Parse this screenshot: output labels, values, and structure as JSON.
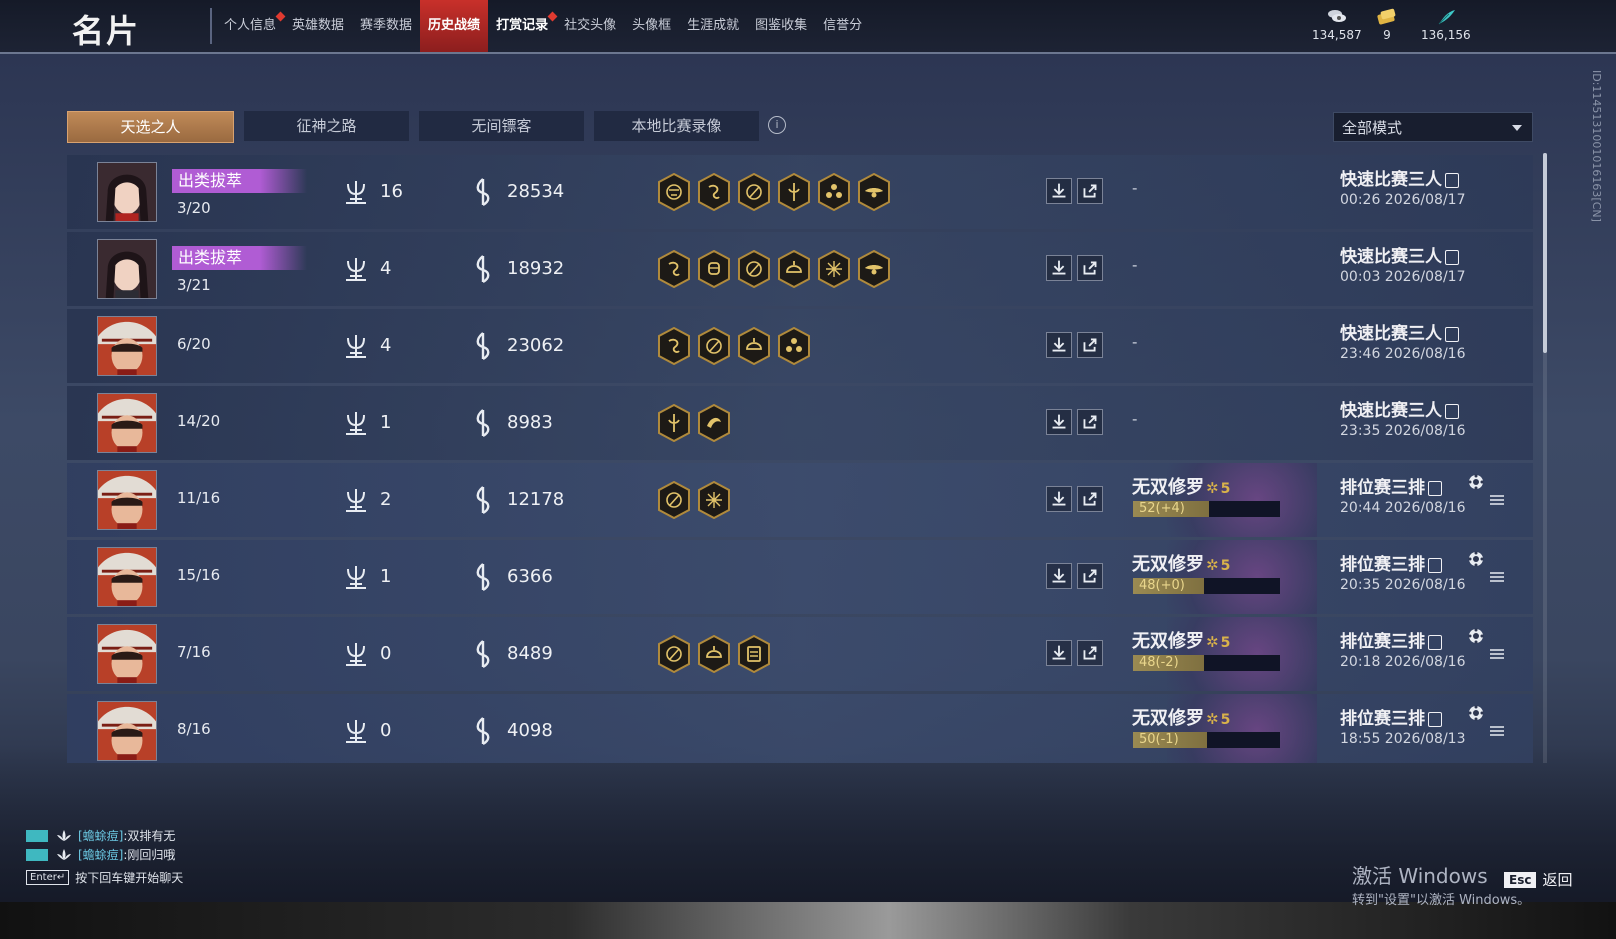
{
  "header": {
    "title": "名片",
    "nav": [
      {
        "label": "个人信息",
        "dot": true
      },
      {
        "label": "英雄数据"
      },
      {
        "label": "赛季数据"
      },
      {
        "label": "历史战绩",
        "active": true
      },
      {
        "label": "打赏记录",
        "dot": true,
        "bold": true
      },
      {
        "label": "社交头像"
      },
      {
        "label": "头像框"
      },
      {
        "label": "生涯成就"
      },
      {
        "label": "图鉴收集"
      },
      {
        "label": "信誉分"
      }
    ],
    "currencies": [
      {
        "icon": "coin-stack-icon",
        "value": "134,587"
      },
      {
        "icon": "ticket-icon",
        "value": "9"
      },
      {
        "icon": "feather-icon",
        "value": "136,156"
      }
    ]
  },
  "tabs": [
    "天选之人",
    "征神之路",
    "无间镖客",
    "本地比赛录像"
  ],
  "active_tab": 0,
  "mode_select": {
    "value": "全部模式"
  },
  "side_id": "ID:1145131001016163[CN]",
  "columns_icons": {
    "kills": "trident-icon",
    "damage": "flame-coin-icon"
  },
  "colors": {
    "accent": "#b05cd4",
    "active_nav": "#c8302a",
    "tab_active": "#b07a4c",
    "hero_star": "#d9b24a"
  },
  "rows": [
    {
      "avatar": "female-hero-1",
      "badge": "出类拔萃",
      "rank": "3/20",
      "kills": "16",
      "damage": "28534",
      "medals": [
        "mask-medal-icon",
        "dragon-medal-icon",
        "swirl-medal-icon",
        "sword-medal-icon",
        "triangle-medal-icon",
        "eagle-medal-icon"
      ],
      "actions": true,
      "hero": null,
      "mode": "快速比赛三人",
      "time": "00:26 2026/08/17"
    },
    {
      "avatar": "female-hero-2",
      "badge": "出类拔萃",
      "rank": "3/21",
      "kills": "4",
      "damage": "18932",
      "medals": [
        "dragon-medal-icon",
        "fist-medal-icon",
        "swirl-medal-icon",
        "helmet-medal-icon",
        "sparkle-medal-icon",
        "eagle-medal-icon"
      ],
      "actions": true,
      "hero": null,
      "mode": "快速比赛三人",
      "time": "00:03 2026/08/17"
    },
    {
      "avatar": "male-hero",
      "badge": null,
      "rank": "6/20",
      "kills": "4",
      "damage": "23062",
      "medals": [
        "dragon-medal-icon",
        "swirl-medal-icon",
        "helmet-medal-icon",
        "triangle-medal-icon"
      ],
      "actions": true,
      "hero": null,
      "mode": "快速比赛三人",
      "time": "23:46 2026/08/16"
    },
    {
      "avatar": "male-hero",
      "badge": null,
      "rank": "14/20",
      "kills": "1",
      "damage": "8983",
      "medals": [
        "sword-medal-icon",
        "bird-medal-icon"
      ],
      "actions": true,
      "hero": null,
      "mode": "快速比赛三人",
      "time": "23:35 2026/08/16"
    },
    {
      "avatar": "male-hero",
      "badge": null,
      "rank": "11/16",
      "kills": "2",
      "damage": "12178",
      "medals": [
        "swirl-medal-icon",
        "sparkle-medal-icon"
      ],
      "actions": true,
      "hero": {
        "name": "无双修罗",
        "stars": "5",
        "bar": "52(+4)",
        "fill": 0.52
      },
      "mode": "排位赛三排",
      "time": "20:44 2026/08/16"
    },
    {
      "avatar": "male-hero",
      "badge": null,
      "rank": "15/16",
      "kills": "1",
      "damage": "6366",
      "medals": [],
      "actions": true,
      "hero": {
        "name": "无双修罗",
        "stars": "5",
        "bar": "48(+0)",
        "fill": 0.48
      },
      "mode": "排位赛三排",
      "time": "20:35 2026/08/16"
    },
    {
      "avatar": "male-hero",
      "badge": null,
      "rank": "7/16",
      "kills": "0",
      "damage": "8489",
      "medals": [
        "swirl-medal-icon",
        "helmet-medal-icon",
        "scroll-medal-icon"
      ],
      "actions": true,
      "hero": {
        "name": "无双修罗",
        "stars": "5",
        "bar": "48(-2)",
        "fill": 0.48
      },
      "mode": "排位赛三排",
      "time": "20:18 2026/08/16"
    },
    {
      "avatar": "male-hero",
      "badge": null,
      "rank": "8/16",
      "kills": "0",
      "damage": "4098",
      "medals": [],
      "actions": false,
      "hero": {
        "name": "无双修罗",
        "stars": "5",
        "bar": "50(-1)",
        "fill": 0.5
      },
      "mode": "排位赛三排",
      "time": "18:55 2026/08/13"
    }
  ],
  "chat": {
    "lines": [
      {
        "name": "[蟾蜍痘]",
        "text": ":双排有无"
      },
      {
        "name": "[蟾蜍痘]",
        "text": ":刚回归哦"
      }
    ],
    "enter_key": "Enter↵",
    "hint": "按下回车键开始聊天"
  },
  "windows_watermark": {
    "line1": "激活 Windows",
    "line2": "转到\"设置\"以激活 Windows。"
  },
  "back": {
    "key": "Esc",
    "label": "返回"
  }
}
